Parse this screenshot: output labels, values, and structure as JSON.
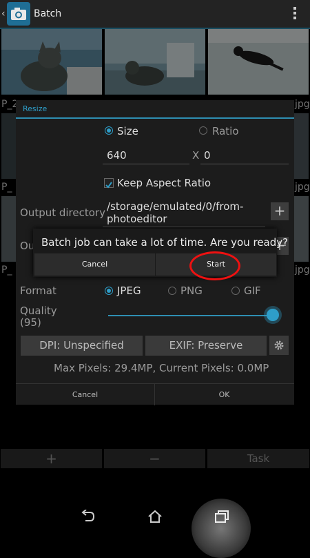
{
  "actionbar": {
    "title": "Batch",
    "back_glyph": "‹",
    "app_icon": "camera-icon",
    "overflow_icon": "overflow-menu-icon"
  },
  "thumbnails": {
    "row_labels": [
      {
        "left": "P_2",
        "right": "jpg"
      },
      {
        "left": "P_",
        "right": "jpg"
      },
      {
        "left": "P_",
        "right": "jpg"
      }
    ]
  },
  "resize": {
    "title": "Resize",
    "mode_size": "Size",
    "mode_ratio": "Ratio",
    "width_value": "640",
    "x_separator": "X",
    "height_value": "0",
    "keep_aspect_label": "Keep Aspect Ratio",
    "keep_aspect_checked": true,
    "output_dir_label": "Output directory",
    "output_dir_value_line1": "/storage/emulated/0/from-",
    "output_dir_value_line2": "photoeditor",
    "output_partial_label": "Ou",
    "format_label": "Format",
    "format_options": [
      "JPEG",
      "PNG",
      "GIF"
    ],
    "format_selected": "JPEG",
    "quality_label_line1": "Quality",
    "quality_label_line2": "(95)",
    "quality_value": 95,
    "dpi_button": "DPI: Unspecified",
    "exif_button": "EXIF: Preserve",
    "settings_icon": "gear-icon",
    "pixels_info": "Max Pixels: 29.4MP, Current Pixels: 0.0MP",
    "cancel": "Cancel",
    "ok": "OK"
  },
  "confirm": {
    "message": "Batch job can take a lot of time. Are you ready?",
    "cancel": "Cancel",
    "start": "Start"
  },
  "toolbar": {
    "add": "+",
    "remove": "−",
    "task": "Task"
  },
  "navbar": {
    "back_icon": "back-icon",
    "home_icon": "home-icon",
    "recents_icon": "recents-icon"
  },
  "colors": {
    "accent": "#2e9ec9",
    "highlight": "#ee1111"
  }
}
